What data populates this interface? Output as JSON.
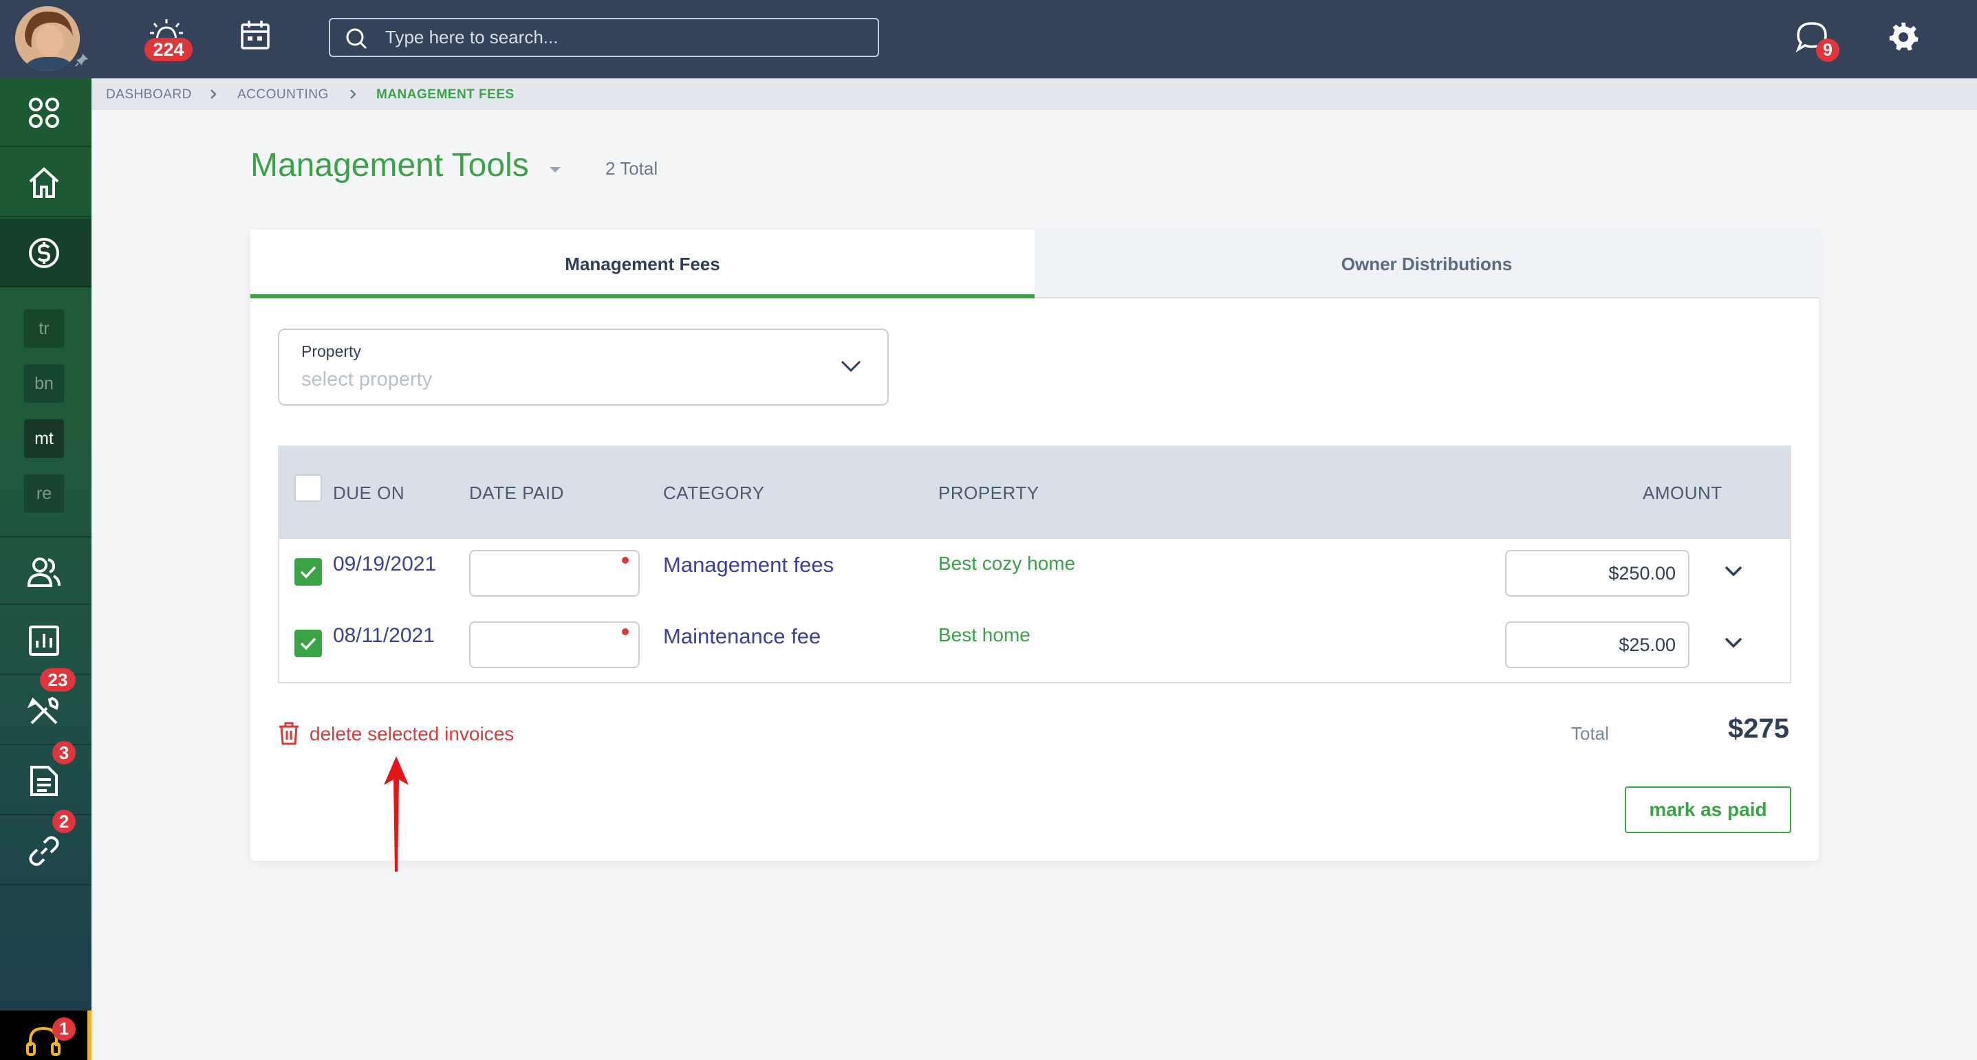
{
  "topbar": {
    "notifications_count": "224",
    "search_placeholder": "Type here to search...",
    "messages_count": "9"
  },
  "sidebar": {
    "modules": [
      "tr",
      "bn",
      "mt",
      "re"
    ],
    "tasks_badge": "23",
    "documents_badge": "3",
    "links_badge": "2",
    "support_badge": "1"
  },
  "breadcrumb": {
    "item1": "DASHBOARD",
    "item2": "ACCOUNTING",
    "item3": "MANAGEMENT FEES"
  },
  "header": {
    "title": "Management Tools",
    "count": "2 Total"
  },
  "tabs": {
    "tab1": "Management Fees",
    "tab2": "Owner Distributions"
  },
  "filter": {
    "label": "Property",
    "placeholder": "select property"
  },
  "table": {
    "headers": {
      "due_on": "DUE ON",
      "date_paid": "DATE PAID",
      "category": "CATEGORY",
      "property": "PROPERTY",
      "amount": "AMOUNT"
    },
    "rows": [
      {
        "due_on": "09/19/2021",
        "category": "Management fees",
        "property": "Best cozy home",
        "amount": "$250.00"
      },
      {
        "due_on": "08/11/2021",
        "category": "Maintenance fee",
        "property": "Best home",
        "amount": "$25.00"
      }
    ]
  },
  "footer": {
    "delete_label": "delete selected invoices",
    "total_label": "Total",
    "total_value": "$275",
    "mark_paid_label": "mark as paid"
  },
  "colors": {
    "accent_green": "#3aa346",
    "topbar": "#34435a",
    "link_blue": "#3b3f9e",
    "danger": "#d93a3a"
  }
}
